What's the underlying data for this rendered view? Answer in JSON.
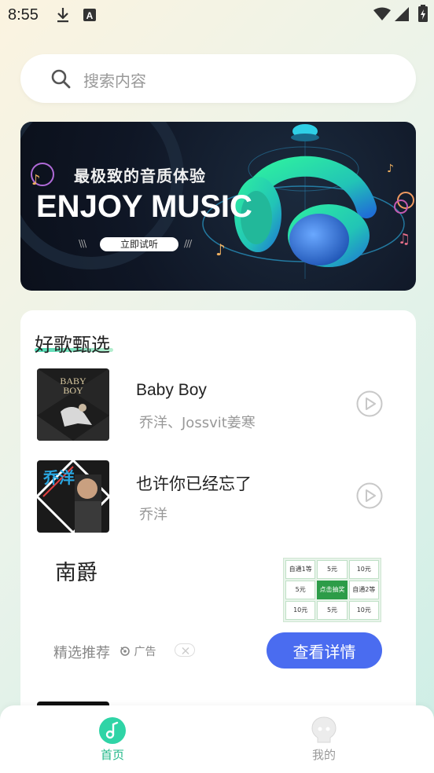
{
  "status_bar": {
    "time": "8:55"
  },
  "search": {
    "placeholder": "搜索内容"
  },
  "banner": {
    "subtitle": "最极致的音质体验",
    "headline": "ENJOY MUSIC",
    "cta_label": "立即试听"
  },
  "section": {
    "title": "好歌甄选",
    "songs": [
      {
        "title": "Baby Boy",
        "artist": "乔洋、Jossvit姜寒",
        "cover_text": "BABY BOY"
      },
      {
        "title": "也许你已经忘了",
        "artist": "乔洋",
        "cover_text": "乔洋"
      }
    ]
  },
  "ad": {
    "title": "南爵",
    "recommend_label": "精选推荐",
    "tag_label": "广告",
    "button_label": "查看详情",
    "grid_cells": [
      "自通1等",
      "5元",
      "10元",
      "5元",
      "点击抽奖",
      "自通2等",
      "10元",
      "5元",
      "10元"
    ]
  },
  "tabbar": {
    "tabs": [
      {
        "label": "首页",
        "active": true
      },
      {
        "label": "我的",
        "active": false
      }
    ]
  },
  "colors": {
    "accent_green": "#2fd4a6",
    "button_blue": "#4a6cf0",
    "tab_active": "#22b889",
    "tab_inactive": "#999999"
  }
}
